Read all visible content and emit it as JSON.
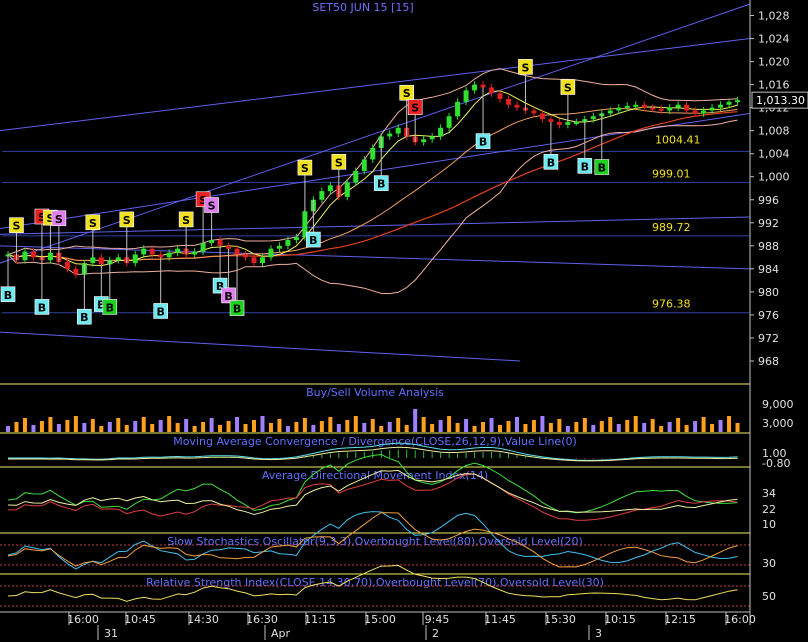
{
  "chart_data": {
    "type": "candlestick",
    "title": "SET50 JUN 15",
    "interval": "[15]",
    "last_price": "1,013.30",
    "price_axis": {
      "range": [
        964,
        1030
      ],
      "ticks": [
        "1,028",
        "1,024",
        "1,020",
        "1,016",
        "1,012",
        "1,008",
        "1,004",
        "1,000",
        "996",
        "992",
        "988",
        "984",
        "980",
        "976",
        "972",
        "968"
      ]
    },
    "level_labels": [
      "1004.41",
      "999.01",
      "989.72",
      "976.38"
    ],
    "price_series_approx": [
      986.5,
      985.5,
      987.0,
      986.0,
      985.5,
      986.8,
      985.2,
      984.0,
      983.0,
      985.0,
      986.0,
      984.8,
      985.5,
      986.0,
      985.0,
      986.5,
      987.5,
      986.5,
      986.0,
      986.8,
      987.5,
      986.5,
      987.0,
      988.5,
      989.0,
      988.0,
      987.5,
      986.5,
      986.0,
      985.0,
      986.0,
      987.5,
      988.0,
      989.0,
      989.5,
      994.0,
      996.0,
      997.5,
      998.5,
      996.5,
      999.0,
      1001.0,
      1003.0,
      1005.0,
      1007.0,
      1007.5,
      1008.5,
      1007.0,
      1006.0,
      1006.5,
      1007.0,
      1008.5,
      1010.5,
      1013.0,
      1015.0,
      1016.0,
      1015.5,
      1014.5,
      1013.5,
      1012.5,
      1012.0,
      1011.5,
      1011.0,
      1010.0,
      1009.5,
      1009.0,
      1009.5,
      1009.5,
      1010.0,
      1010.5,
      1011.0,
      1011.5,
      1012.0,
      1012.3,
      1012.5,
      1012.0,
      1011.8,
      1011.5,
      1012.0,
      1012.5,
      1011.5,
      1011.0,
      1011.5,
      1012.0,
      1012.5,
      1013.0,
      1013.3
    ],
    "buy_sell_markers": [
      {
        "label": "S",
        "color": "#f0e020",
        "idx": 1
      },
      {
        "label": "S",
        "color": "#e82020",
        "idx": 4
      },
      {
        "label": "S",
        "color": "#f0e020",
        "idx": 5
      },
      {
        "label": "S",
        "color": "#e080f0",
        "idx": 6
      },
      {
        "label": "S",
        "color": "#f0e020",
        "idx": 10
      },
      {
        "label": "S",
        "color": "#f0e020",
        "idx": 14
      },
      {
        "label": "S",
        "color": "#f0e020",
        "idx": 21
      },
      {
        "label": "S",
        "color": "#e82020",
        "idx": 23
      },
      {
        "label": "S",
        "color": "#e080f0",
        "idx": 24
      },
      {
        "label": "S",
        "color": "#f0e020",
        "idx": 35
      },
      {
        "label": "S",
        "color": "#f0e020",
        "idx": 39
      },
      {
        "label": "S",
        "color": "#f0e020",
        "idx": 47
      },
      {
        "label": "S",
        "color": "#e82020",
        "idx": 48
      },
      {
        "label": "S",
        "color": "#f0e020",
        "idx": 61
      },
      {
        "label": "S",
        "color": "#f0e020",
        "idx": 66
      },
      {
        "label": "B",
        "color": "#70e8f0",
        "idx": 0
      },
      {
        "label": "B",
        "color": "#70e8f0",
        "idx": 4
      },
      {
        "label": "B",
        "color": "#70e8f0",
        "idx": 9
      },
      {
        "label": "B",
        "color": "#70e8f0",
        "idx": 11
      },
      {
        "label": "B",
        "color": "#20d020",
        "idx": 12
      },
      {
        "label": "B",
        "color": "#70e8f0",
        "idx": 18
      },
      {
        "label": "B",
        "color": "#70e8f0",
        "idx": 25
      },
      {
        "label": "B",
        "color": "#e080f0",
        "idx": 26
      },
      {
        "label": "B",
        "color": "#20d020",
        "idx": 27
      },
      {
        "label": "B",
        "color": "#70e8f0",
        "idx": 36
      },
      {
        "label": "B",
        "color": "#70e8f0",
        "idx": 44
      },
      {
        "label": "B",
        "color": "#70e8f0",
        "idx": 56
      },
      {
        "label": "B",
        "color": "#70e8f0",
        "idx": 64
      },
      {
        "label": "B",
        "color": "#70e8f0",
        "idx": 68
      },
      {
        "label": "B",
        "color": "#20d020",
        "idx": 70
      }
    ],
    "panels": [
      {
        "name": "Buy/Sell Volume Analysis",
        "ticks": [
          "9,000",
          "3,000"
        ]
      },
      {
        "name": "Moving Average Convergence / Divergence(CLOSE,26,12,9),Value Line(0)",
        "ticks": [
          "1.00",
          "-0.80"
        ]
      },
      {
        "name": "Average Directional Movement Index(14)",
        "ticks": [
          "34",
          "22",
          "10"
        ]
      },
      {
        "name": "Slow Stochastics Oscillator(9,3,3),Overbought Level(80),Oversold Level(20)",
        "ticks": [
          "30"
        ]
      },
      {
        "name": "Relative Strength Index(CLOSE,14,30,70),Overbought Level(70),Oversold Level(30)",
        "ticks": [
          "50"
        ]
      }
    ],
    "x_axis": {
      "time_labels": [
        "16:00",
        "10:45",
        "14:30",
        "16:30",
        "11:15",
        "15:00",
        "9:45",
        "11:45",
        "15:30",
        "10:15",
        "12:15",
        "16:00"
      ],
      "date_labels": [
        "31",
        "Apr",
        "2",
        "3"
      ]
    },
    "colors": {
      "background": "#000000",
      "up": "#30e030",
      "down": "#e02020",
      "bollinger": "#f0b0a0",
      "ma_fast": "#f0f060",
      "ma_slow": "#e04020",
      "trend_blue": "#6060f0",
      "grid": "#3040a0",
      "volume_buy": "#ffa020",
      "volume_sell": "#a080ff"
    }
  }
}
